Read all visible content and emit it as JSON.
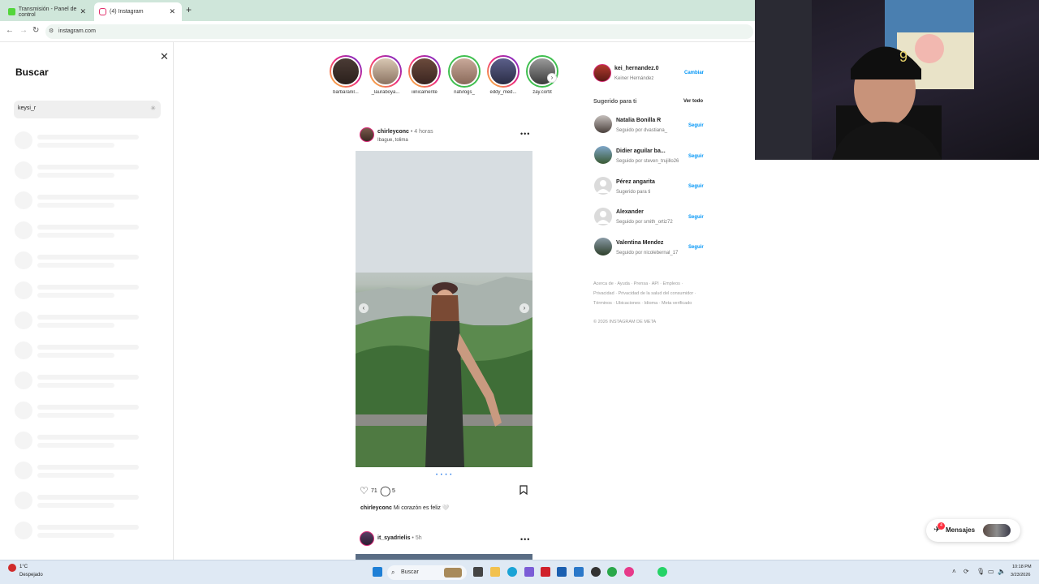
{
  "browser": {
    "tabs": [
      {
        "label": "Transmisión - Panel de control",
        "favicon_color": "#53d63b"
      },
      {
        "label": "(4) Instagram",
        "favicon_color": "#e1306c"
      }
    ],
    "new_tab": "+",
    "url": "instagram.com"
  },
  "search_panel": {
    "title": "Buscar",
    "query": "keysi_r",
    "skeleton_rows": 14
  },
  "stories": [
    {
      "name": "barbaranil...",
      "ring": "#d62976"
    },
    {
      "name": "_lauraboya...",
      "ring": "#d62976"
    },
    {
      "name": "iiinicamente",
      "ring": "#d62976"
    },
    {
      "name": "natvlogs_",
      "ring": "#3fbf4f"
    },
    {
      "name": "eddy_med...",
      "ring": "#d62976"
    },
    {
      "name": "zay.cortit",
      "ring": "#3fbf4f"
    }
  ],
  "post": {
    "username": "chirleyconc",
    "time": "• 4 horas",
    "location": "Ibague, tolima",
    "likes": "71",
    "comments": "5",
    "caption_user": "chirleyconc",
    "caption_text": "Mi corazón es feliz 🤍"
  },
  "next_post": {
    "username": "it_syadrielis",
    "time": "• 5h"
  },
  "sidebar": {
    "current_user": {
      "username": "kei_hernandez.0",
      "full_name": "Keiner Hernández",
      "switch_label": "Cambiar"
    },
    "suggested_title": "Sugerido para ti",
    "see_all": "Ver todo",
    "suggestions": [
      {
        "name": "Natalia Bonilla R",
        "sub": "Seguido por dvastiana_",
        "follow": "Seguir"
      },
      {
        "name": "Didier aguilar ba...",
        "sub": "Seguido por steven_trujillo26",
        "follow": "Seguir"
      },
      {
        "name": "Pérez angarita",
        "sub": "Sugerido para ti",
        "follow": "Seguir"
      },
      {
        "name": "Alexander",
        "sub": "Seguido por smith_ortiz72",
        "follow": "Seguir"
      },
      {
        "name": "Valentina Mendez",
        "sub": "Seguido por nicolebernal_17",
        "follow": "Seguir"
      }
    ],
    "footer_line1": "Acerca de · Ayuda · Prensa · API · Empleos ·",
    "footer_line2": "Privacidad · Privacidad de la salud del consumidor ·",
    "footer_line3": "Términos · Ubicaciones · Idioma · Meta verificado",
    "copyright": "© 2026 INSTAGRAM DE META"
  },
  "messages": {
    "label": "Mensajes",
    "badge": "4"
  },
  "taskbar": {
    "weather_temp": "1°C",
    "weather_desc": "Despejado",
    "search_label": "Buscar",
    "time": "10:18 PM",
    "date": "3/23/2026"
  }
}
